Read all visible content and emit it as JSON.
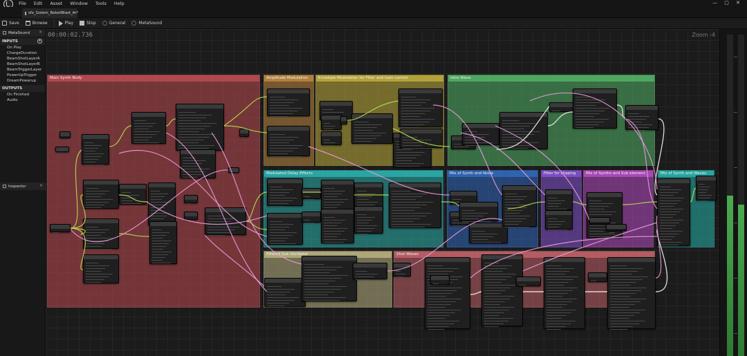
{
  "menubar": {
    "items": [
      "File",
      "Edit",
      "Asset",
      "Window",
      "Tools",
      "Help"
    ],
    "window_controls": "— ▢ ✕"
  },
  "tab": {
    "label": "sfx_Golem_RobotBlast_m*",
    "close": "×"
  },
  "toolbar": {
    "save": "Save",
    "browse": "Browse",
    "play": "Play",
    "stop": "Stop",
    "general": "General",
    "metasound": "MetaSound"
  },
  "left_panel": {
    "tab": "MetaSound",
    "inputs_header": "INPUTS",
    "inputs": [
      "On Play",
      "ChargeDuration",
      "BeamShotLayerA",
      "BeamShotLayerB",
      "BeamTriggerLayer",
      "PowerUpTrigger",
      "DreamPowerup"
    ],
    "outputs_header": "OUTPUTS",
    "outputs": [
      "On Finished",
      "Audio"
    ],
    "inspector_tab": "Inspector"
  },
  "graph": {
    "timecode": "00:00:02.736",
    "zoom": "Zoom -4",
    "comments": [
      {
        "title": "Main Synth Body",
        "color": "#b0484f"
      },
      {
        "title": "Amplitude Modulation",
        "color": "#b1803c"
      },
      {
        "title": "Envelope Modulation for Filter and Gain control",
        "color": "#b3a23a"
      },
      {
        "title": "Intro Wave",
        "color": "#4ea660"
      },
      {
        "title": "Modulated Delay Effects",
        "color": "#29a5a2"
      },
      {
        "title": "Mix of Synth and Noise",
        "color": "#2f63b0"
      },
      {
        "title": "Filter for shaping",
        "color": "#7c4ec2"
      },
      {
        "title": "Mix of Synths and Sub element",
        "color": "#a848b6"
      },
      {
        "title": "Mix of Synth and Waves",
        "color": "#27a59f"
      },
      {
        "title": "Filtered Sub Oscillator",
        "color": "#ada779"
      },
      {
        "title": "Shot Waves",
        "color": "#b45c62"
      }
    ]
  },
  "colors": {
    "wire_green": "#b5e04a",
    "wire_pink": "#e89ad8",
    "wire_white": "#e8e8e8",
    "meter_green": "#4caa50"
  },
  "meters": {
    "left_level": 0.5,
    "right_level": 0.47
  }
}
